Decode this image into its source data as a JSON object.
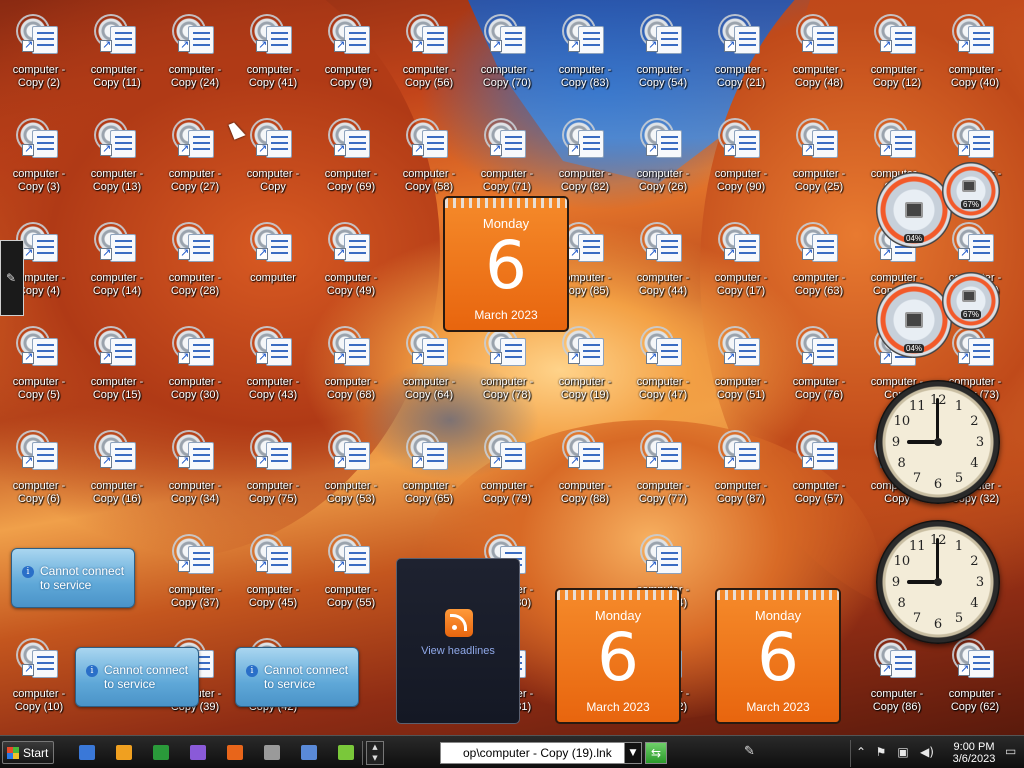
{
  "desktop": {
    "icon_columns": [
      [
        "computer - Copy (2)",
        "computer - Copy (3)",
        "computer - Copy (4)",
        "computer - Copy (5)",
        "computer - Copy (6)",
        "",
        "computer - Copy (10)"
      ],
      [
        "computer - Copy (11)",
        "computer - Copy (13)",
        "computer - Copy (14)",
        "computer - Copy (15)",
        "computer - Copy (16)",
        "",
        ""
      ],
      [
        "computer - Copy (24)",
        "computer - Copy (27)",
        "computer - Copy (28)",
        "computer - Copy (30)",
        "computer - Copy (34)",
        "computer - Copy (37)",
        "computer - Copy (39)"
      ],
      [
        "computer - Copy (41)",
        "computer - Copy",
        "computer",
        "computer - Copy (43)",
        "computer - Copy (75)",
        "computer - Copy (45)",
        "computer - Copy (42)"
      ],
      [
        "computer - Copy (9)",
        "computer - Copy (69)",
        "computer - Copy (49)",
        "computer - Copy (68)",
        "computer - Copy (53)",
        "computer - Copy (55)",
        ""
      ],
      [
        "computer - Copy (56)",
        "computer - Copy (58)",
        "",
        "computer - Copy (64)",
        "computer - Copy (65)",
        "",
        ""
      ],
      [
        "computer - Copy (70)",
        "computer - Copy (71)",
        "",
        "computer - Copy (78)",
        "computer - Copy (79)",
        "computer - Copy (80)",
        "computer - Copy (81)"
      ],
      [
        "computer - Copy (83)",
        "computer - Copy (82)",
        "computer - Copy (85)",
        "computer - Copy (19)",
        "computer - Copy (88)",
        "",
        ""
      ],
      [
        "computer - Copy (54)",
        "computer - Copy (26)",
        "computer - Copy (44)",
        "computer - Copy (47)",
        "computer - Copy (77)",
        "computer - Copy (84)",
        "computer - Copy (72)"
      ],
      [
        "computer - Copy (21)",
        "computer - Copy (90)",
        "computer - Copy (17)",
        "computer - Copy (51)",
        "computer - Copy (87)",
        "",
        ""
      ],
      [
        "computer - Copy (48)",
        "computer - Copy (25)",
        "computer - Copy (63)",
        "computer - Copy (76)",
        "computer - Copy (57)",
        "",
        ""
      ],
      [
        "computer - Copy (12)",
        "computer - Copy",
        "computer - Copy (74)",
        "computer - Copy",
        "computer - Copy",
        "",
        "computer - Copy (86)"
      ],
      [
        "computer - Copy (40)",
        "computer - Copy",
        "computer - Copy (61)",
        "computer - Copy (73)",
        "computer - Copy (32)",
        "",
        "computer - Copy (62)"
      ]
    ],
    "gadgets": {
      "calendars": [
        {
          "day": "Monday",
          "date": "6",
          "month": "March 2023"
        },
        {
          "day": "Monday",
          "date": "6",
          "month": "March 2023"
        },
        {
          "day": "Monday",
          "date": "6",
          "month": "March 2023"
        }
      ],
      "cpu_meters": [
        {
          "cpu": "04%",
          "memory": "67%"
        },
        {
          "cpu": "04%",
          "memory": "67%"
        }
      ],
      "clocks": [
        {
          "hour": 9,
          "minute": 0
        },
        {
          "hour": 9,
          "minute": 0
        }
      ],
      "clock_numerals": [
        "12",
        "1",
        "2",
        "3",
        "4",
        "5",
        "6",
        "7",
        "8",
        "9",
        "10",
        "11"
      ],
      "weather_notices": [
        {
          "message": "Cannot connect to service"
        },
        {
          "message": "Cannot connect to service"
        },
        {
          "message": "Cannot connect to service"
        }
      ],
      "feed": {
        "link": "View headlines",
        "icon": "rss-icon"
      }
    }
  },
  "taskbar": {
    "start_label": "Start",
    "quick_launch": [
      {
        "icon": "show-desktop-icon",
        "color": "#3a78d8"
      },
      {
        "icon": "media-player-icon",
        "color": "#f0a020"
      },
      {
        "icon": "spreadsheet-icon",
        "color": "#2a9a3a"
      },
      {
        "icon": "messenger-icon",
        "color": "#8a5ad8"
      },
      {
        "icon": "firefox-icon",
        "color": "#e8651a"
      },
      {
        "icon": "calculator-icon",
        "color": "#9a9a9a"
      },
      {
        "icon": "monitor-icon",
        "color": "#5a8ad8"
      },
      {
        "icon": "paint-icon",
        "color": "#7ac83a"
      }
    ],
    "address": "op\\computer - Copy (19).lnk",
    "clock": {
      "time": "9:00 PM",
      "date": "3/6/2023"
    }
  }
}
